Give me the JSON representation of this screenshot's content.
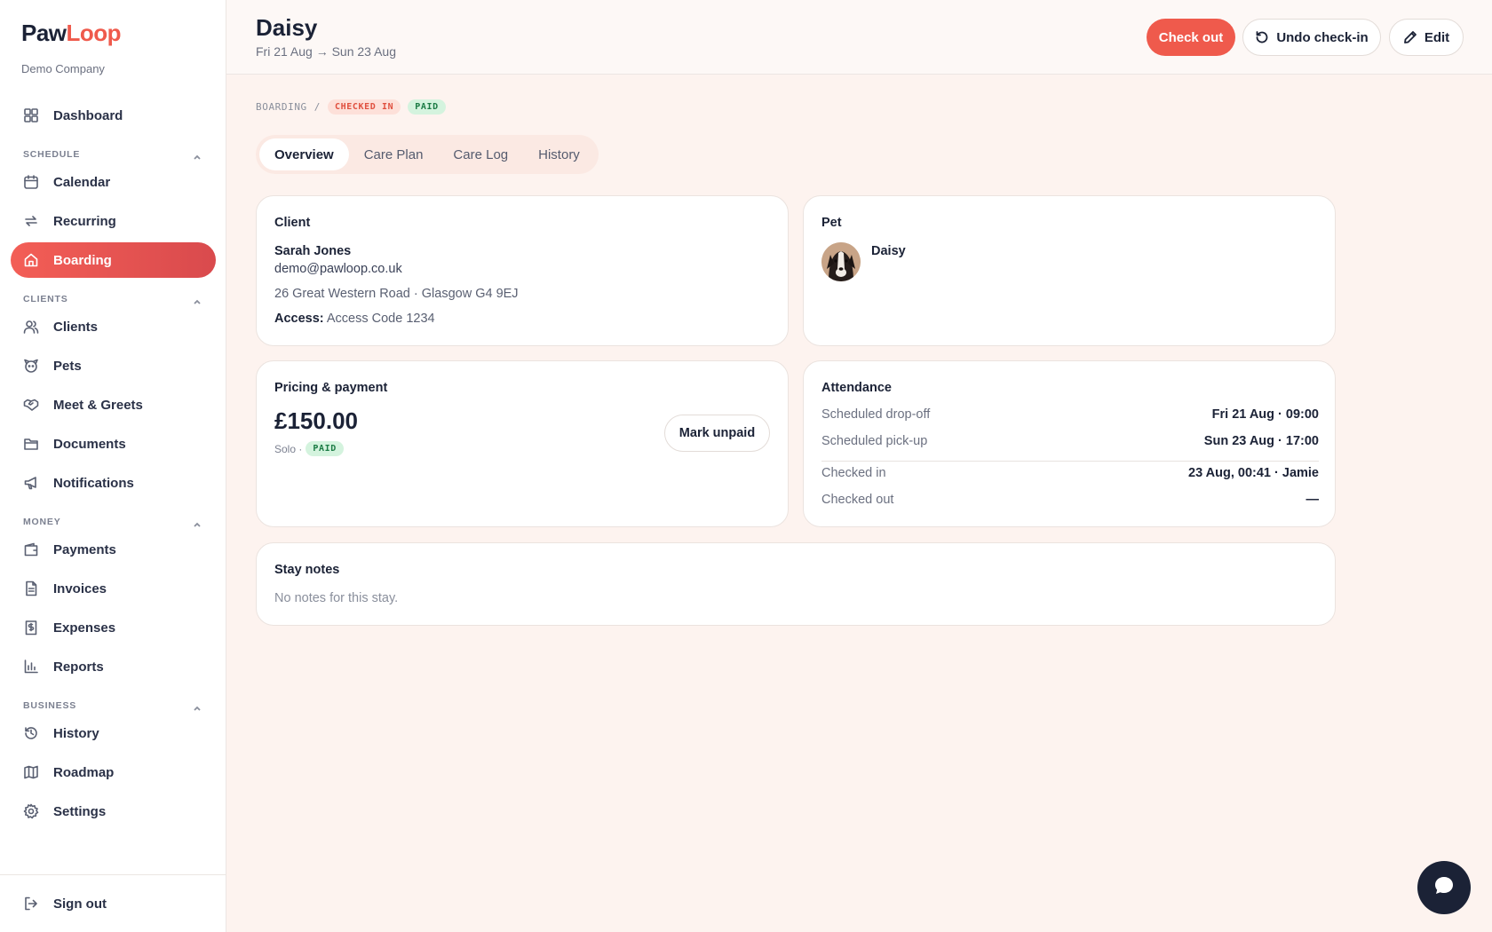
{
  "app": {
    "logo": {
      "part1": "Paw",
      "part2": "Loop"
    },
    "company": "Demo Company"
  },
  "sidebar": {
    "dashboard": "Dashboard",
    "sections": {
      "schedule": "SCHEDULE",
      "clients": "CLIENTS",
      "money": "MONEY",
      "business": "BUSINESS"
    },
    "items": {
      "calendar": "Calendar",
      "recurring": "Recurring",
      "boarding": "Boarding",
      "clients": "Clients",
      "pets": "Pets",
      "meet_greets": "Meet & Greets",
      "documents": "Documents",
      "notifications": "Notifications",
      "payments": "Payments",
      "invoices": "Invoices",
      "expenses": "Expenses",
      "reports": "Reports",
      "history": "History",
      "roadmap": "Roadmap",
      "settings": "Settings"
    },
    "active": "boarding",
    "sign_out": "Sign out"
  },
  "header": {
    "title": "Daisy",
    "subtitle": "Fri 21 Aug → Sun 23 Aug",
    "check_out": "Check out",
    "undo_check_in": "Undo check-in",
    "edit": "Edit"
  },
  "breadcrumb": {
    "section": "BOARDING",
    "separator": "/",
    "status": "CHECKED IN",
    "payment": "PAID"
  },
  "tabs": [
    "Overview",
    "Care Plan",
    "Care Log",
    "History"
  ],
  "client": {
    "title": "Client",
    "name": "Sarah Jones",
    "email": "demo@pawloop.co.uk",
    "address": "26 Great Western Road · Glasgow G4 9EJ",
    "access_label": "Access:",
    "access_value": "Access Code 1234"
  },
  "pet": {
    "title": "Pet",
    "name": "Daisy"
  },
  "pricing": {
    "title": "Pricing & payment",
    "amount": "£150.00",
    "plan": "Solo ·",
    "badge": "PAID",
    "mark_unpaid": "Mark unpaid"
  },
  "attendance": {
    "title": "Attendance",
    "rows": [
      {
        "label": "Scheduled drop-off",
        "value": "Fri 21 Aug · 09:00"
      },
      {
        "label": "Scheduled pick-up",
        "value": "Sun 23 Aug · 17:00"
      },
      {
        "label": "Checked in",
        "value": "23 Aug, 00:41 · Jamie"
      },
      {
        "label": "Checked out",
        "value": "—"
      }
    ]
  },
  "notes": {
    "title": "Stay notes",
    "empty": "No notes for this stay."
  },
  "colors": {
    "accent": "#ef5a4c",
    "navy": "#1b2236",
    "paid_bg": "#d4f3de",
    "page_bg": "#fdf3ef"
  }
}
